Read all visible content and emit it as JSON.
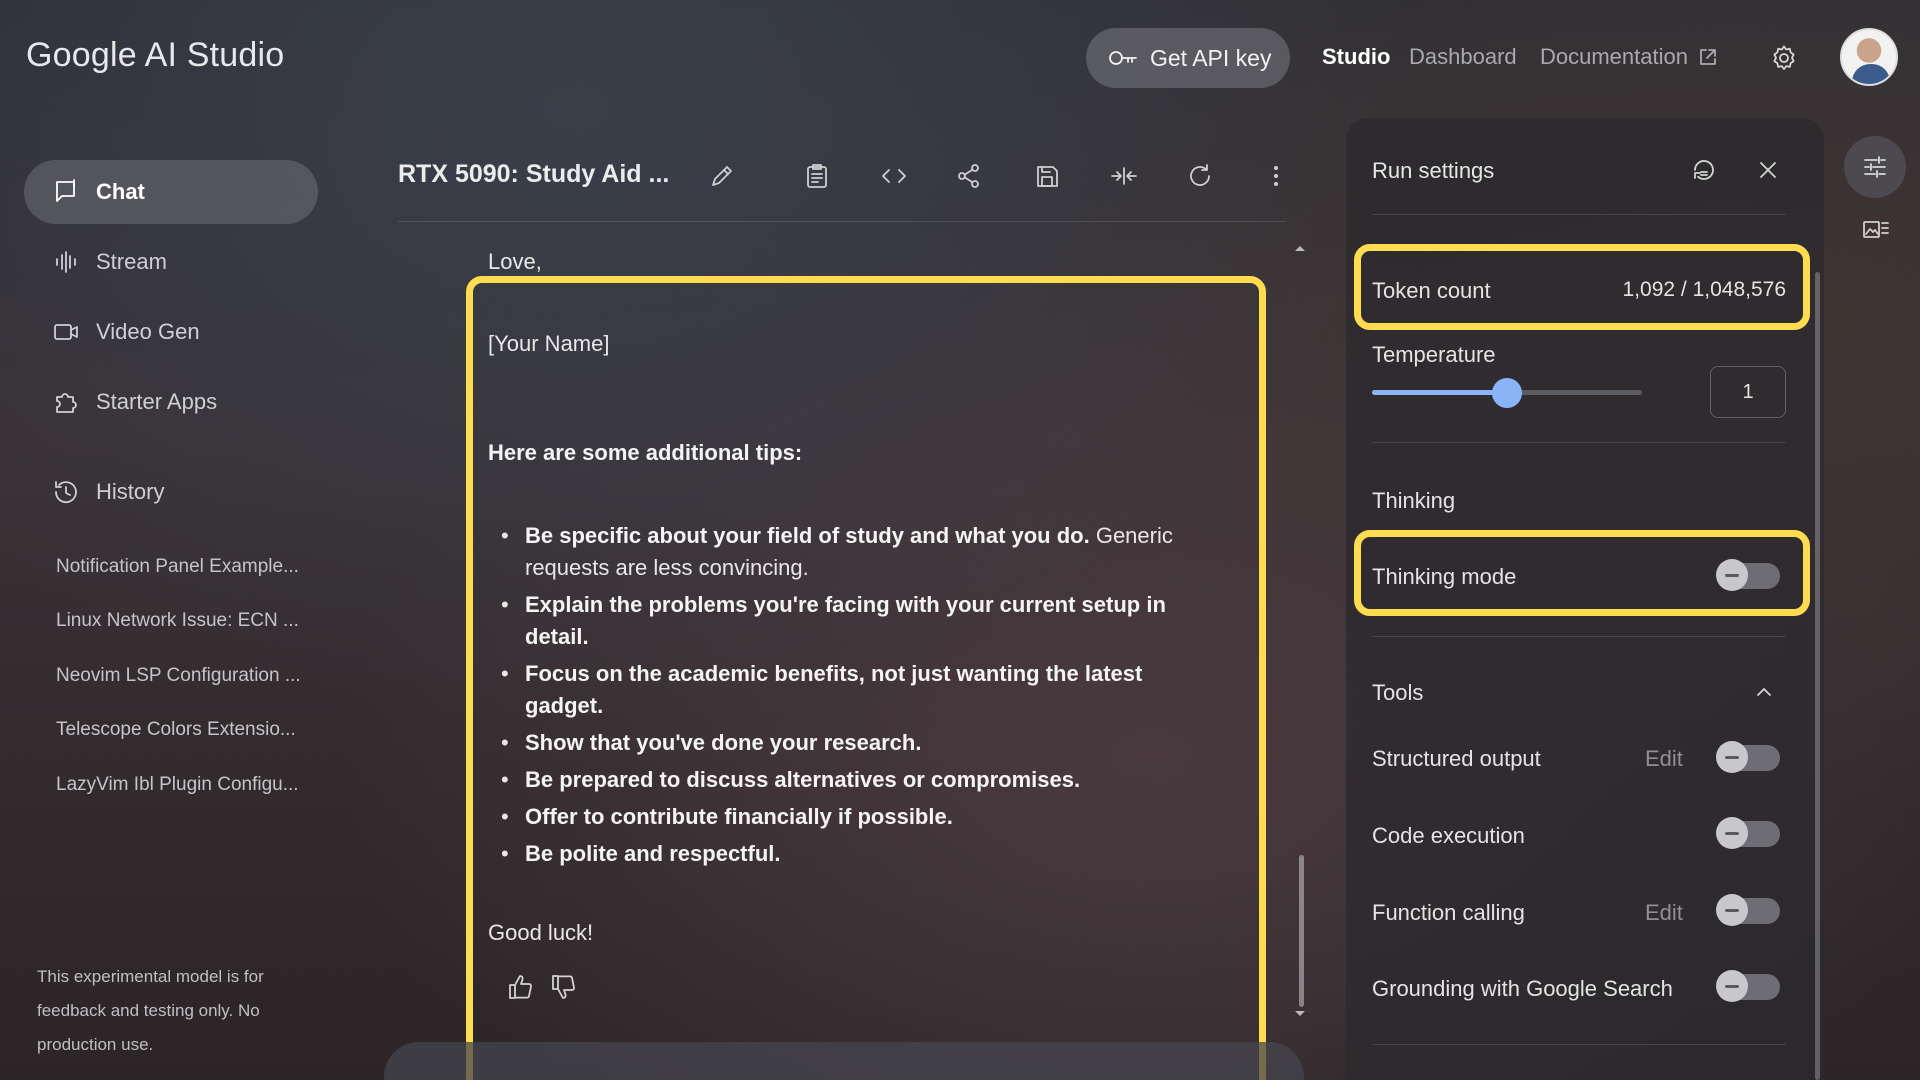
{
  "app": {
    "brand": "Google AI Studio",
    "get_api_key": "Get API key",
    "nav": {
      "studio": "Studio",
      "dashboard": "Dashboard",
      "documentation": "Documentation"
    }
  },
  "sidebar": {
    "items": [
      {
        "label": "Chat",
        "icon": "chat-icon"
      },
      {
        "label": "Stream",
        "icon": "stream-icon"
      },
      {
        "label": "Video Gen",
        "icon": "video-icon"
      },
      {
        "label": "Starter Apps",
        "icon": "puzzle-icon"
      },
      {
        "label": "History",
        "icon": "history-icon"
      }
    ],
    "history": [
      "Notification Panel Example...",
      "Linux Network Issue: ECN ...",
      "Neovim LSP Configuration ...",
      "Telescope Colors Extensio...",
      "LazyVim Ibl Plugin Configu..."
    ],
    "disclaimer": "This experimental model is for feedback and testing only. No production use."
  },
  "chat": {
    "title": "RTX 5090: Study Aid ...",
    "closing": "Love,",
    "name_placeholder": "[Your Name]",
    "tips_heading": "Here are some additional tips:",
    "tips": [
      {
        "bold": "Be specific about your field of study and what you do.",
        "rest": " Generic requests are less convincing."
      },
      {
        "bold": "Explain the problems you're facing with your current setup in detail.",
        "rest": ""
      },
      {
        "bold": "Focus on the academic benefits, not just wanting the latest gadget.",
        "rest": ""
      },
      {
        "bold": "Show that you've done your research.",
        "rest": ""
      },
      {
        "bold": "Be prepared to discuss alternatives or compromises.",
        "rest": ""
      },
      {
        "bold": "Offer to contribute financially if possible.",
        "rest": ""
      },
      {
        "bold": "Be polite and respectful.",
        "rest": ""
      }
    ],
    "sign_off": "Good luck!"
  },
  "run_settings": {
    "title": "Run settings",
    "token_count_label": "Token count",
    "token_count_value": "1,092 / 1,048,576",
    "temperature_label": "Temperature",
    "temperature_value": "1",
    "temperature_fraction": 0.5,
    "thinking_heading": "Thinking",
    "thinking_mode_label": "Thinking mode",
    "tools_heading": "Tools",
    "tools": [
      {
        "label": "Structured output",
        "edit": "Edit"
      },
      {
        "label": "Code execution",
        "edit": ""
      },
      {
        "label": "Function calling",
        "edit": "Edit"
      },
      {
        "label": "Grounding with Google Search",
        "edit": ""
      }
    ]
  },
  "colors": {
    "highlight": "#fddc4f",
    "accent": "#8ab4f8"
  }
}
